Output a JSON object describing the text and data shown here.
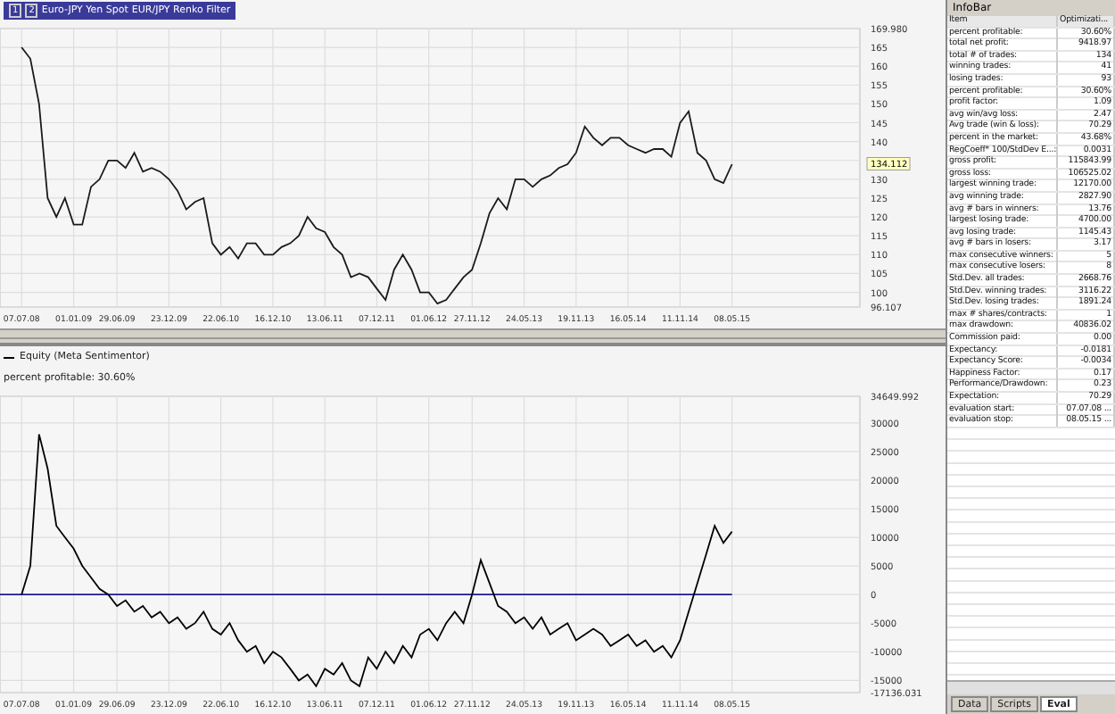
{
  "price_chart": {
    "legend": {
      "badges": [
        "1",
        "2"
      ],
      "instrument": "Euro-JPY Yen Spot",
      "strategy": "EUR/JPY Renko Filter"
    },
    "chart_data": {
      "type": "line",
      "categories": [
        "07.07.08",
        null,
        null,
        null,
        null,
        null,
        "01.01.09",
        null,
        null,
        null,
        null,
        "29.06.09",
        null,
        null,
        null,
        null,
        null,
        "23.12.09",
        null,
        null,
        null,
        null,
        null,
        "22.06.10",
        null,
        null,
        null,
        null,
        null,
        "16.12.10",
        null,
        null,
        null,
        null,
        null,
        "13.06.11",
        null,
        null,
        null,
        null,
        null,
        "07.12.11",
        null,
        null,
        null,
        null,
        null,
        "01.06.12",
        null,
        null,
        null,
        null,
        "27.11.12",
        null,
        null,
        null,
        null,
        null,
        "24.05.13",
        null,
        null,
        null,
        null,
        null,
        "19.11.13",
        null,
        null,
        null,
        null,
        null,
        "16.05.14",
        null,
        null,
        null,
        null,
        null,
        "11.11.14",
        null,
        null,
        null,
        null,
        null,
        "08.05.15"
      ],
      "series": [
        {
          "color": "#1a1a1a",
          "values": [
            165,
            162,
            150,
            125,
            120,
            125,
            118,
            118,
            128,
            130,
            135,
            135,
            133,
            137,
            132,
            133,
            132,
            130,
            127,
            122,
            124,
            125,
            113,
            110,
            112,
            109,
            113,
            113,
            110,
            110,
            112,
            113,
            115,
            120,
            117,
            116,
            112,
            110,
            104,
            105,
            104,
            101,
            98,
            106,
            110,
            106,
            100,
            100,
            97,
            98,
            101,
            104,
            106,
            113,
            121,
            125,
            122,
            130,
            130,
            128,
            130,
            131,
            133,
            134,
            137,
            144,
            141,
            139,
            141,
            141,
            139,
            138,
            137,
            138,
            138,
            136,
            145,
            148,
            137,
            135,
            130,
            129,
            134
          ]
        }
      ],
      "ylim": [
        96.107,
        169.98
      ],
      "grid": true,
      "yticks": [
        {
          "value": 169.98,
          "label": "169.980"
        },
        165,
        160,
        155,
        150,
        145,
        140,
        135,
        130,
        125,
        120,
        115,
        110,
        105,
        100,
        {
          "value": 96.107,
          "label": "96.107"
        }
      ]
    },
    "current_value": "134.112"
  },
  "equity_chart": {
    "legend": {
      "title": "Equity (Meta Sentimentor)",
      "note": "percent profitable: 30.60%"
    },
    "chart_data": {
      "type": "line",
      "categories": [
        "07.07.08",
        null,
        null,
        null,
        null,
        null,
        "01.01.09",
        null,
        null,
        null,
        null,
        "29.06.09",
        null,
        null,
        null,
        null,
        null,
        "23.12.09",
        null,
        null,
        null,
        null,
        null,
        "22.06.10",
        null,
        null,
        null,
        null,
        null,
        "16.12.10",
        null,
        null,
        null,
        null,
        null,
        "13.06.11",
        null,
        null,
        null,
        null,
        null,
        "07.12.11",
        null,
        null,
        null,
        null,
        null,
        "01.06.12",
        null,
        null,
        null,
        null,
        "27.11.12",
        null,
        null,
        null,
        null,
        null,
        "24.05.13",
        null,
        null,
        null,
        null,
        null,
        "19.11.13",
        null,
        null,
        null,
        null,
        null,
        "16.05.14",
        null,
        null,
        null,
        null,
        null,
        "11.11.14",
        null,
        null,
        null,
        null,
        null,
        "08.05.15"
      ],
      "series": [
        {
          "color": "#000000",
          "values": [
            0,
            5000,
            28000,
            22000,
            12000,
            10000,
            8000,
            5000,
            3000,
            1000,
            0,
            -2000,
            -1000,
            -3000,
            -2000,
            -4000,
            -3000,
            -5000,
            -4000,
            -6000,
            -5000,
            -3000,
            -6000,
            -7000,
            -5000,
            -8000,
            -10000,
            -9000,
            -12000,
            -10000,
            -11000,
            -13000,
            -15000,
            -14000,
            -16000,
            -13000,
            -14000,
            -12000,
            -15000,
            -16000,
            -11000,
            -13000,
            -10000,
            -12000,
            -9000,
            -11000,
            -7000,
            -6000,
            -8000,
            -5000,
            -3000,
            -5000,
            0,
            6000,
            2000,
            -2000,
            -3000,
            -5000,
            -4000,
            -6000,
            -4000,
            -7000,
            -6000,
            -5000,
            -8000,
            -7000,
            -6000,
            -7000,
            -9000,
            -8000,
            -7000,
            -9000,
            -8000,
            -10000,
            -9000,
            -11000,
            -8000,
            -3000,
            2000,
            7000,
            12000,
            9000,
            11000
          ]
        }
      ],
      "ylim": [
        -17136.031,
        34649.992
      ],
      "grid": true,
      "ref_lines": [
        {
          "axis": "y",
          "value": 0,
          "color": "#1c1c8c"
        }
      ],
      "yticks": [
        {
          "value": 34649.992,
          "label": "34649.992"
        },
        30000,
        25000,
        20000,
        15000,
        10000,
        5000,
        0,
        -5000,
        -10000,
        -15000,
        {
          "value": -17136.031,
          "label": "-17136.031"
        }
      ]
    }
  },
  "infobar": {
    "title": "InfoBar",
    "columns": [
      "Item",
      "Optimizati..."
    ],
    "rows": [
      {
        "item": "percent profitable:",
        "value": "30.60%"
      },
      {
        "item": "total net profit:",
        "value": "9418.97"
      },
      {
        "item": "total # of trades:",
        "value": "134"
      },
      {
        "item": "winning trades:",
        "value": "41"
      },
      {
        "item": "losing trades:",
        "value": "93"
      },
      {
        "item": "percent profitable:",
        "value": "30.60%"
      },
      {
        "item": "profit factor:",
        "value": "1.09"
      },
      {
        "item": "avg win/avg loss:",
        "value": "2.47"
      },
      {
        "item": "Avg trade (win & loss):",
        "value": "70.29"
      },
      {
        "item": "percent in the market:",
        "value": "43.68%"
      },
      {
        "item": "RegCoeff* 100/StdDev E...:",
        "value": "0.0031"
      },
      {
        "item": "gross profit:",
        "value": "115843.99"
      },
      {
        "item": "gross loss:",
        "value": "106525.02"
      },
      {
        "item": "largest winning trade:",
        "value": "12170.00"
      },
      {
        "item": "avg winning trade:",
        "value": "2827.90"
      },
      {
        "item": "avg # bars in winners:",
        "value": "13.76"
      },
      {
        "item": "largest losing trade:",
        "value": "4700.00"
      },
      {
        "item": "avg losing trade:",
        "value": "1145.43"
      },
      {
        "item": "avg # bars in losers:",
        "value": "3.17"
      },
      {
        "item": "max consecutive winners:",
        "value": "5"
      },
      {
        "item": "max consecutive losers:",
        "value": "8"
      },
      {
        "item": "Std.Dev. all trades:",
        "value": "2668.76"
      },
      {
        "item": "Std.Dev. winning trades:",
        "value": "3116.22"
      },
      {
        "item": "Std.Dev. losing trades:",
        "value": "1891.24"
      },
      {
        "item": "max # shares/contracts:",
        "value": "1"
      },
      {
        "item": "max drawdown:",
        "value": "40836.02"
      },
      {
        "item": "Commission paid:",
        "value": "0.00"
      },
      {
        "item": "Expectancy:",
        "value": "-0.0181"
      },
      {
        "item": "Expectancy Score:",
        "value": "-0.0034"
      },
      {
        "item": "Happiness Factor:",
        "value": "0.17"
      },
      {
        "item": "Performance/Drawdown:",
        "value": "0.23"
      },
      {
        "item": "Expectation:",
        "value": "70.29"
      },
      {
        "item": "evaluation start:",
        "value": "07.07.08 ..."
      },
      {
        "item": "evaluation stop:",
        "value": "08.05.15 ..."
      }
    ],
    "tabs": [
      {
        "label": "Data",
        "selected": false
      },
      {
        "label": "Scripts",
        "selected": false
      },
      {
        "label": "Eval",
        "selected": true
      }
    ]
  }
}
